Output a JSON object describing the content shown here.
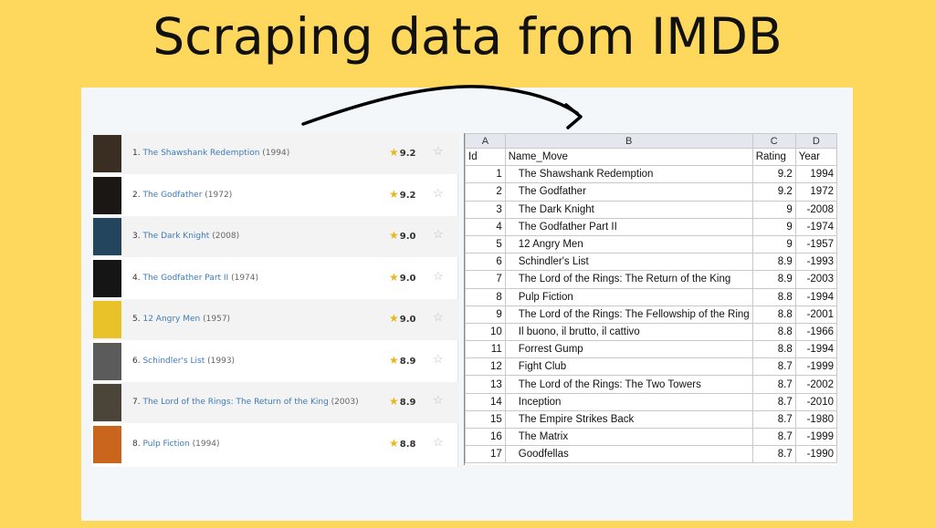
{
  "headline": "Scraping data from IMDB",
  "imdb_list": [
    {
      "rank": "1.",
      "title": "The Shawshank Redemption",
      "year": "(1994)",
      "rating": "9.2",
      "poster": "#3a2e22"
    },
    {
      "rank": "2.",
      "title": "The Godfather",
      "year": "(1972)",
      "rating": "9.2",
      "poster": "#1b1714"
    },
    {
      "rank": "3.",
      "title": "The Dark Knight",
      "year": "(2008)",
      "rating": "9.0",
      "poster": "#24455e"
    },
    {
      "rank": "4.",
      "title": "The Godfather Part II",
      "year": "(1974)",
      "rating": "9.0",
      "poster": "#151515"
    },
    {
      "rank": "5.",
      "title": "12 Angry Men",
      "year": "(1957)",
      "rating": "9.0",
      "poster": "#e9c22a"
    },
    {
      "rank": "6.",
      "title": "Schindler's List",
      "year": "(1993)",
      "rating": "8.9",
      "poster": "#5b5b5b"
    },
    {
      "rank": "7.",
      "title": "The Lord of the Rings: The Return of the King",
      "year": "(2003)",
      "rating": "8.9",
      "poster": "#4a4538"
    },
    {
      "rank": "8.",
      "title": "Pulp Fiction",
      "year": "(1994)",
      "rating": "8.8",
      "poster": "#c9651c"
    }
  ],
  "sheet": {
    "columns": [
      "A",
      "B",
      "C",
      "D"
    ],
    "header": [
      "Id",
      "Name_Move",
      "Rating",
      "Year"
    ],
    "rows": [
      [
        "1",
        "The Shawshank Redemption",
        "9.2",
        "1994"
      ],
      [
        "2",
        "The Godfather",
        "9.2",
        "1972"
      ],
      [
        "3",
        "The Dark Knight",
        "9",
        "-2008"
      ],
      [
        "4",
        "The Godfather Part II",
        "9",
        "-1974"
      ],
      [
        "5",
        "12 Angry Men",
        "9",
        "-1957"
      ],
      [
        "6",
        "Schindler's List",
        "8.9",
        "-1993"
      ],
      [
        "7",
        "The Lord of the Rings: The Return of the King",
        "8.9",
        "-2003"
      ],
      [
        "8",
        "Pulp Fiction",
        "8.8",
        "-1994"
      ],
      [
        "9",
        "The Lord of the Rings: The Fellowship of the Ring",
        "8.8",
        "-2001"
      ],
      [
        "10",
        "Il buono, il brutto, il cattivo",
        "8.8",
        "-1966"
      ],
      [
        "11",
        "Forrest Gump",
        "8.8",
        "-1994"
      ],
      [
        "12",
        "Fight Club",
        "8.7",
        "-1999"
      ],
      [
        "13",
        "The Lord of the Rings: The Two Towers",
        "8.7",
        "-2002"
      ],
      [
        "14",
        "Inception",
        "8.7",
        "-2010"
      ],
      [
        "15",
        "The Empire Strikes Back",
        "8.7",
        "-1980"
      ],
      [
        "16",
        "The Matrix",
        "8.7",
        "-1999"
      ],
      [
        "17",
        "Goodfellas",
        "8.7",
        "-1990"
      ]
    ]
  }
}
